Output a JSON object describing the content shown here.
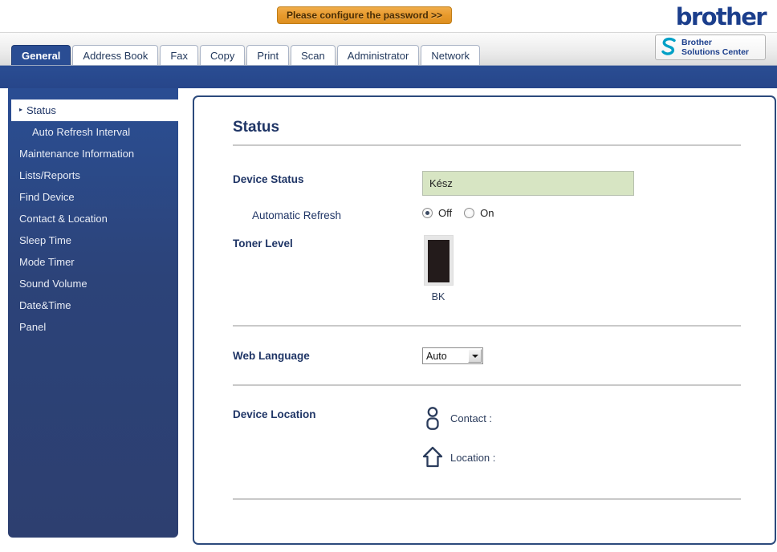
{
  "header": {
    "password_banner": "Please configure the password >>",
    "brand_logo": "brother",
    "solutions_center": {
      "line1": "Brother",
      "line2": "Solutions Center",
      "icon": "s-swoosh-icon"
    }
  },
  "tabs": [
    {
      "label": "General",
      "active": true
    },
    {
      "label": "Address Book",
      "active": false
    },
    {
      "label": "Fax",
      "active": false
    },
    {
      "label": "Copy",
      "active": false
    },
    {
      "label": "Print",
      "active": false
    },
    {
      "label": "Scan",
      "active": false
    },
    {
      "label": "Administrator",
      "active": false
    },
    {
      "label": "Network",
      "active": false
    }
  ],
  "sidebar": {
    "items": [
      {
        "label": "Status",
        "active": true,
        "sub": false,
        "bullet": "▸"
      },
      {
        "label": "Auto Refresh Interval",
        "active": false,
        "sub": true
      },
      {
        "label": "Maintenance Information",
        "active": false,
        "sub": false
      },
      {
        "label": "Lists/Reports",
        "active": false,
        "sub": false
      },
      {
        "label": "Find Device",
        "active": false,
        "sub": false
      },
      {
        "label": "Contact & Location",
        "active": false,
        "sub": false
      },
      {
        "label": "Sleep Time",
        "active": false,
        "sub": false
      },
      {
        "label": "Mode Timer",
        "active": false,
        "sub": false
      },
      {
        "label": "Sound Volume",
        "active": false,
        "sub": false
      },
      {
        "label": "Date&Time",
        "active": false,
        "sub": false
      },
      {
        "label": "Panel",
        "active": false,
        "sub": false
      }
    ]
  },
  "main": {
    "title": "Status",
    "device_status": {
      "label": "Device Status",
      "value": "Kész"
    },
    "automatic_refresh": {
      "label": "Automatic Refresh",
      "options": [
        {
          "label": "Off",
          "selected": true
        },
        {
          "label": "On",
          "selected": false
        }
      ]
    },
    "toner_level": {
      "label": "Toner Level",
      "cartridge": "BK",
      "fill_percent": 96
    },
    "web_language": {
      "label": "Web Language",
      "value": "Auto"
    },
    "device_location": {
      "label": "Device Location",
      "contact": {
        "icon": "person-icon",
        "label": "Contact :",
        "value": ""
      },
      "location": {
        "icon": "house-icon",
        "label": "Location :",
        "value": ""
      }
    }
  },
  "colors": {
    "brand_blue": "#2a4d93",
    "navy_text": "#1f3566",
    "status_green": "#d7e5c3",
    "banner_orange": "#e89a2c",
    "swoosh_cyan": "#00a0c6"
  }
}
